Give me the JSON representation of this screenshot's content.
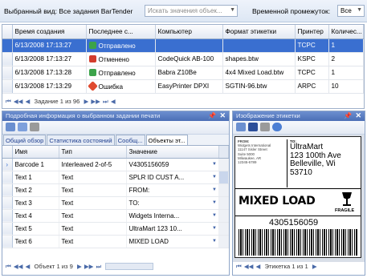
{
  "top": {
    "view_label": "Выбранный вид: Все задания BarTender",
    "search_placeholder": "Искать значения объек...",
    "period_label": "Временной промежуток:",
    "period_value": "Все"
  },
  "jobs": {
    "columns": [
      "Время создания",
      "Последнее с...",
      "Компьютер",
      "Формат этикетки",
      "Принтер",
      "Количес..."
    ],
    "rows": [
      {
        "time": "6/13/2008 17:13:27",
        "status": "Отправлено",
        "status_kind": "sent",
        "computer": "",
        "format": "",
        "printer": "TCPC",
        "qty": "1"
      },
      {
        "time": "6/13/2008 17:13:27",
        "status": "Отменено",
        "status_kind": "cancel",
        "computer": "CodeQuick AB-100",
        "format": "shapes.btw",
        "printer": "KSPC",
        "qty": "2"
      },
      {
        "time": "6/13/2008 17:13:28",
        "status": "Отправлено",
        "status_kind": "sent",
        "computer": "Babra Z10Be",
        "format": "4x4 Mixed Load.btw",
        "printer": "TCPC",
        "qty": "1"
      },
      {
        "time": "6/13/2008 17:13:29",
        "status": "Ошибка",
        "status_kind": "error",
        "computer": "EasyPrinter DPXI",
        "format": "SGTIN-96.btw",
        "printer": "ARPC",
        "qty": "10"
      }
    ],
    "nav_text": "Задание 1 из 96"
  },
  "details": {
    "title": "Подробная информация о выбранном задании печати",
    "tabs": [
      "Общий обзор",
      "Статистика состояний",
      "Сообщ...",
      "Объекты эт..."
    ],
    "active_tab": 3,
    "columns": [
      "Имя",
      "Тип",
      "Значение"
    ],
    "rows": [
      {
        "name": "Barcode 1",
        "type": "Interleaved 2-of-5",
        "value": "V4305156059"
      },
      {
        "name": "Text 1",
        "type": "Text",
        "value": "SPLR ID CUST A..."
      },
      {
        "name": "Text 2",
        "type": "Text",
        "value": "FROM:"
      },
      {
        "name": "Text 3",
        "type": "Text",
        "value": "TO:"
      },
      {
        "name": "Text 4",
        "type": "Text",
        "value": "Widgets Interna..."
      },
      {
        "name": "Text 5",
        "type": "Text",
        "value": "UltraMart 123 10..."
      },
      {
        "name": "Text 6",
        "type": "Text",
        "value": "MIXED LOAD"
      }
    ],
    "nav_text": "Объект 1 из 9"
  },
  "preview": {
    "title": "Изображение этикетки",
    "nav_text": "Этикетка 1 из 1",
    "label": {
      "from_tag": "FROM:",
      "from_lines": [
        "Widgets International",
        "11147 Sisler Street",
        "Suite 5000",
        "Milwaukee, AR",
        "12345-6789"
      ],
      "to_tag": "TO:",
      "to_lines": [
        "UltraMart",
        "123 100th Ave",
        "Belleville, Wi",
        "53710"
      ],
      "mixed": "MIXED LOAD",
      "fragile": "FRAGILE",
      "number": "4305156059"
    }
  },
  "colors": {
    "accent": "#3a6fd0",
    "panel_title": "#4b6fb6"
  }
}
